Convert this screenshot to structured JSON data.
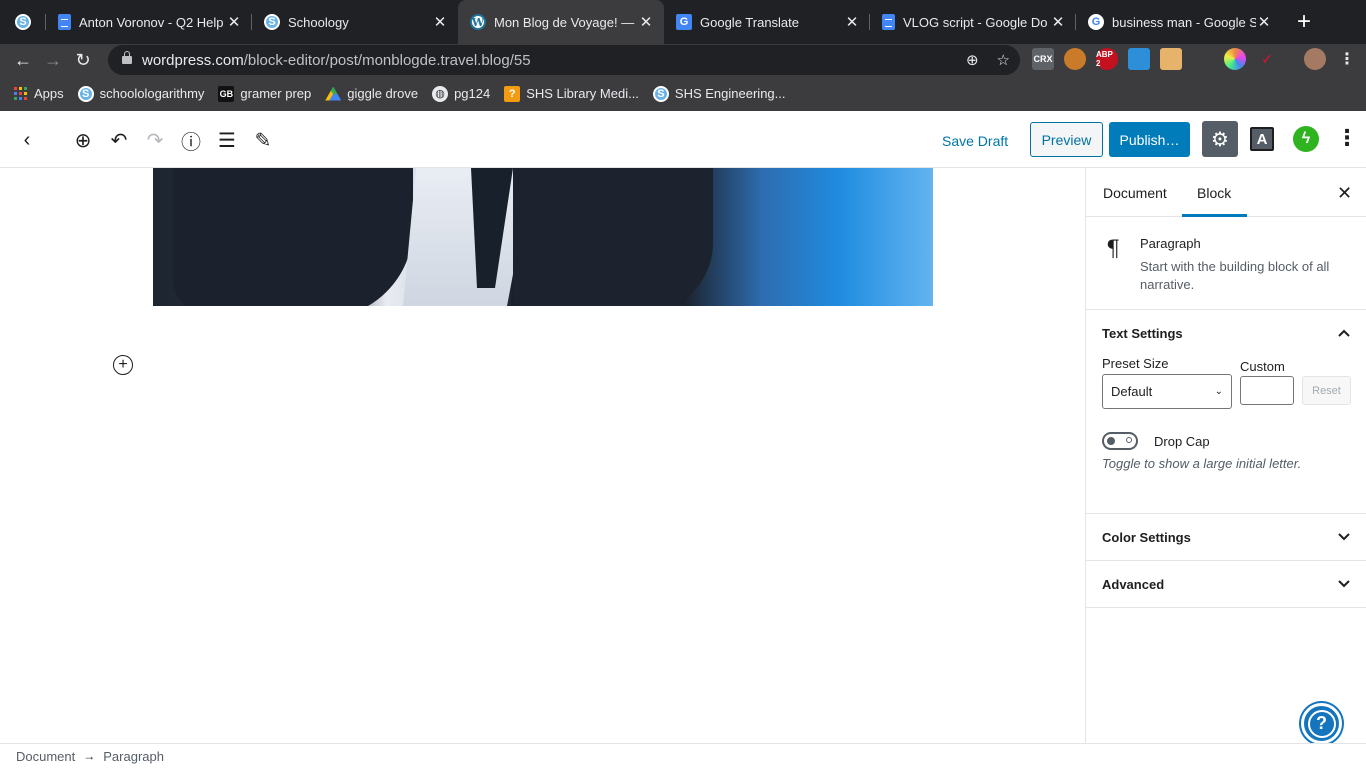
{
  "browser": {
    "tabs": [
      {
        "title": "",
        "favicon": "schoology-icon"
      },
      {
        "title": "Anton Voronov - Q2 Help",
        "favicon": "google-docs-icon"
      },
      {
        "title": "Schoology",
        "favicon": "schoology-icon"
      },
      {
        "title": "Mon Blog de Voyage! — V",
        "favicon": "wordpress-icon",
        "active": true
      },
      {
        "title": "Google Translate",
        "favicon": "google-translate-icon"
      },
      {
        "title": "VLOG script - Google Do",
        "favicon": "google-docs-icon"
      },
      {
        "title": "business man - Google S",
        "favicon": "google-icon"
      }
    ],
    "close_glyph": "✕",
    "new_tab_glyph": "+",
    "url_host": "wordpress.com",
    "url_path": "/block-editor/post/monblogde.travel.blog/55",
    "extensions": [
      "CRX",
      "ABP 2"
    ],
    "bookmarks": [
      {
        "label": "Apps",
        "icon": "apps-grid-icon"
      },
      {
        "label": "schoolologarithmy",
        "icon": "schoology-icon"
      },
      {
        "label": "gramer prep",
        "icon": "gb-icon"
      },
      {
        "label": "giggle drove",
        "icon": "google-drive-icon"
      },
      {
        "label": "pg124",
        "icon": "globe-icon"
      },
      {
        "label": "SHS Library Medi...",
        "icon": "library-icon"
      },
      {
        "label": "SHS Engineering...",
        "icon": "schoology-icon"
      }
    ]
  },
  "editor": {
    "save_draft": "Save Draft",
    "preview": "Preview",
    "publish": "Publish…",
    "font_button": "A"
  },
  "sidebar": {
    "tabs": [
      "Document",
      "Block"
    ],
    "active_tab": "Block",
    "block_card": {
      "title": "Paragraph",
      "description": "Start with the building block of all narrative."
    },
    "text_settings": {
      "title": "Text Settings",
      "preset_label": "Preset Size",
      "preset_value": "Default",
      "custom_label": "Custom",
      "custom_value": "",
      "reset": "Reset",
      "drop_cap_label": "Drop Cap",
      "drop_cap_on": false,
      "drop_cap_help": "Toggle to show a large initial letter."
    },
    "color_settings": {
      "title": "Color Settings"
    },
    "advanced": {
      "title": "Advanced"
    }
  },
  "footer": {
    "breadcrumb": [
      "Document",
      "Paragraph"
    ],
    "separator": "→"
  },
  "colors": {
    "wp_blue": "#007cba",
    "browser_dark": "#202124",
    "jetpack_green": "#2fb41f"
  }
}
